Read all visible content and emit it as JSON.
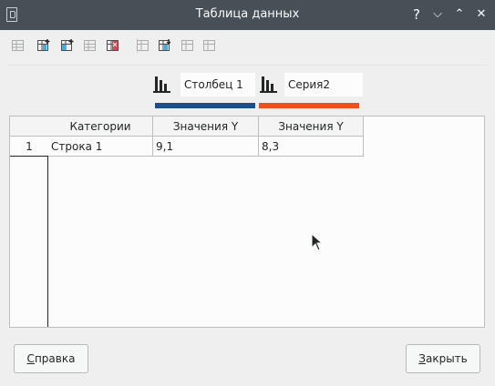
{
  "window": {
    "title": "Таблица данных",
    "help_glyph": "?",
    "minimize_glyph": "⌵",
    "maximize_glyph": "⌃",
    "close_glyph": "✕"
  },
  "toolbar": {
    "icons": [
      "insert-row-icon",
      "insert-series-icon",
      "insert-text-column-icon",
      "delete-row-icon",
      "delete-series-icon",
      "move-up-icon",
      "move-down-icon",
      "move-left-icon",
      "move-right-icon"
    ]
  },
  "series": [
    {
      "name": "Столбец 1",
      "color": "#1c4f8a"
    },
    {
      "name": "Серия2",
      "color": "#f0501e"
    }
  ],
  "table": {
    "headers": [
      "Категории",
      "Значения Y",
      "Значения Y"
    ],
    "rows": [
      {
        "number": "1",
        "category": "Строка 1",
        "values": [
          "9,1",
          "8,3"
        ]
      }
    ]
  },
  "buttons": {
    "help_mnemonic": "С",
    "help_rest": "правка",
    "close_mnemonic": "З",
    "close_rest": "акрыть"
  }
}
